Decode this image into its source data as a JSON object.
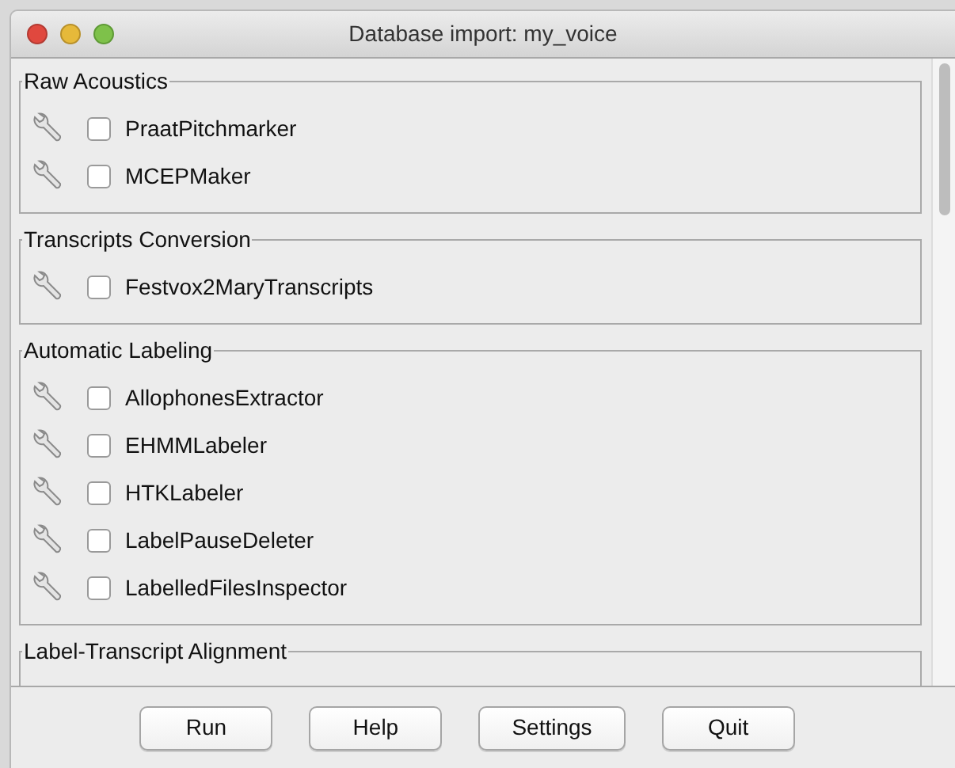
{
  "window": {
    "title": "Database import: my_voice"
  },
  "sections": [
    {
      "title": "Raw Acoustics",
      "items": [
        {
          "label": "PraatPitchmarker",
          "checked": false
        },
        {
          "label": "MCEPMaker",
          "checked": false
        }
      ]
    },
    {
      "title": "Transcripts Conversion",
      "items": [
        {
          "label": "Festvox2MaryTranscripts",
          "checked": false
        }
      ]
    },
    {
      "title": "Automatic Labeling",
      "items": [
        {
          "label": "AllophonesExtractor",
          "checked": false
        },
        {
          "label": "EHMMLabeler",
          "checked": false
        },
        {
          "label": "HTKLabeler",
          "checked": false
        },
        {
          "label": "LabelPauseDeleter",
          "checked": false
        },
        {
          "label": "LabelledFilesInspector",
          "checked": false
        }
      ]
    },
    {
      "title": "Label-Transcript Alignment"
    }
  ],
  "buttons": [
    "Run",
    "Help",
    "Settings",
    "Quit"
  ]
}
